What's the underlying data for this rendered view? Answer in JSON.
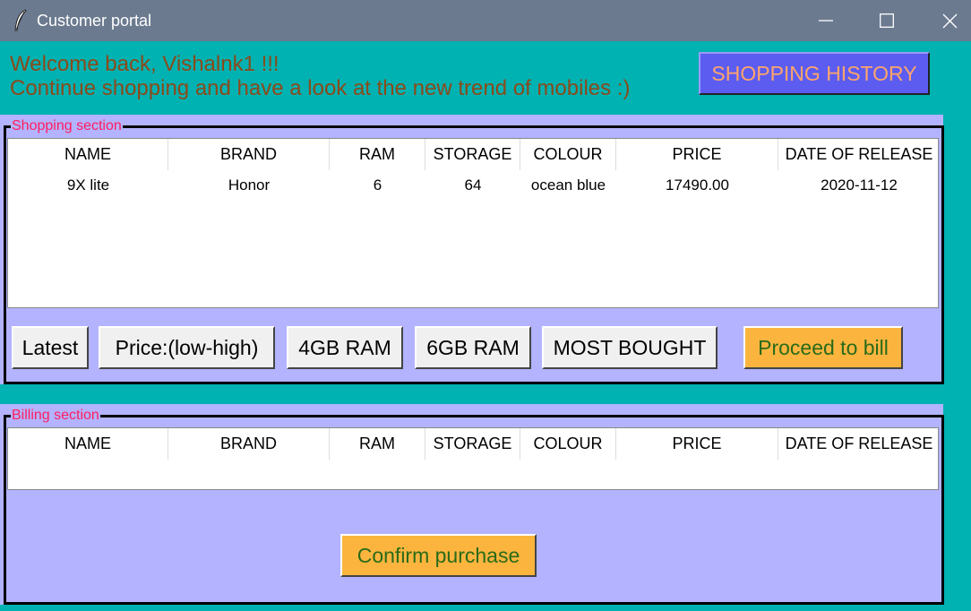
{
  "window": {
    "title": "Customer portal",
    "minimize_icon": "minimize-icon",
    "maximize_icon": "maximize-icon",
    "close_icon": "close-icon"
  },
  "welcome": {
    "line1": "Welcome back, Vishalnk1 !!!",
    "line2": "Continue shopping and have a look at the new trend of mobiles :)"
  },
  "history_button": "SHOPPING HISTORY",
  "shopping": {
    "label": "Shopping section",
    "columns": [
      "NAME",
      "BRAND",
      "RAM",
      "STORAGE",
      "COLOUR",
      "PRICE",
      "DATE OF RELEASE"
    ],
    "rows": [
      [
        "9X lite",
        "Honor",
        "6",
        "64",
        "ocean blue",
        "17490.00",
        "2020-11-12"
      ]
    ],
    "buttons": {
      "latest": "Latest",
      "price": "Price:(low-high)",
      "ram4": "4GB RAM",
      "ram6": "6GB RAM",
      "most_bought": "MOST BOUGHT",
      "proceed": "Proceed to bill"
    }
  },
  "billing": {
    "label": "Billing section",
    "columns": [
      "NAME",
      "BRAND",
      "RAM",
      "STORAGE",
      "COLOUR",
      "PRICE",
      "DATE OF RELEASE"
    ],
    "confirm": "Confirm purchase"
  },
  "colors": {
    "background": "#00b2b2",
    "frame": "#b3b3ff",
    "label": "#ff1d5e",
    "welcome_text": "#8b4a1a",
    "history_bg": "#5c5cf0",
    "history_text": "#ffa56b",
    "orange_button": "#fbb53f",
    "orange_button_text": "#2a6a18"
  }
}
